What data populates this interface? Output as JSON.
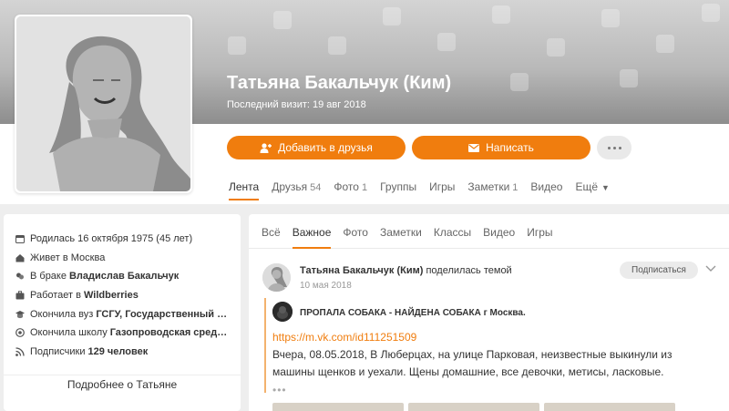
{
  "profile": {
    "name": "Татьяна Бакальчук (Ким)",
    "last_visit": "Последний визит: 19 авг 2018"
  },
  "actions": {
    "add_friend": "Добавить в друзья",
    "write": "Написать"
  },
  "icons": {
    "add_friend": "add-user-icon",
    "write": "envelope-icon",
    "more": "more-dots-icon"
  },
  "colors": {
    "accent": "#f07d0e",
    "cover_bottom": "#8d8d8d"
  },
  "profile_tabs": [
    {
      "label": "Лента",
      "count": ""
    },
    {
      "label": "Друзья",
      "count": "54"
    },
    {
      "label": "Фото",
      "count": "1"
    },
    {
      "label": "Группы",
      "count": ""
    },
    {
      "label": "Игры",
      "count": ""
    },
    {
      "label": "Заметки",
      "count": "1"
    },
    {
      "label": "Видео",
      "count": ""
    },
    {
      "label": "Ещё",
      "count": ""
    }
  ],
  "info": [
    {
      "text": "Родилась 16 октября 1975 (45 лет)",
      "bold": "",
      "icon": "calendar-icon"
    },
    {
      "text": "Живет в Москва",
      "bold": "",
      "icon": "home-icon"
    },
    {
      "text": "В браке",
      "bold": "Владислав Бакальчук",
      "icon": "hearts-icon"
    },
    {
      "text": "Работает в",
      "bold": "Wildberries",
      "icon": "briefcase-icon"
    },
    {
      "text": "Окончила вуз",
      "bold": "ГСГУ, Государственный соци...",
      "icon": "graduation-cap-icon"
    },
    {
      "text": "Окончила школу",
      "bold": "Газопроводская средняя ...",
      "icon": "school-icon"
    },
    {
      "text": "Подписчики",
      "bold": "129 человек",
      "icon": "feed-icon"
    }
  ],
  "more_about": "Подробнее о Татьяне",
  "feed_tabs": [
    "Всё",
    "Важное",
    "Фото",
    "Заметки",
    "Классы",
    "Видео",
    "Игры"
  ],
  "post": {
    "author": "Татьяна Бакальчук (Ким)",
    "action": "поделилась темой",
    "date": "10 мая 2018",
    "subscribe": "Подписаться",
    "group_title": "ПРОПАЛА СОБАКА - НАЙДЕНА СОБАКА г Москва.",
    "link": "https://m.vk.com/id111251509",
    "text": "Вчера, 08.05.2018, В Люберцах, на улице Парковая, неизвестные выкинули из машины щенков и уехали. Щены домашние, все девочки, метисы, ласковые.",
    "ellipsis": "•••"
  }
}
